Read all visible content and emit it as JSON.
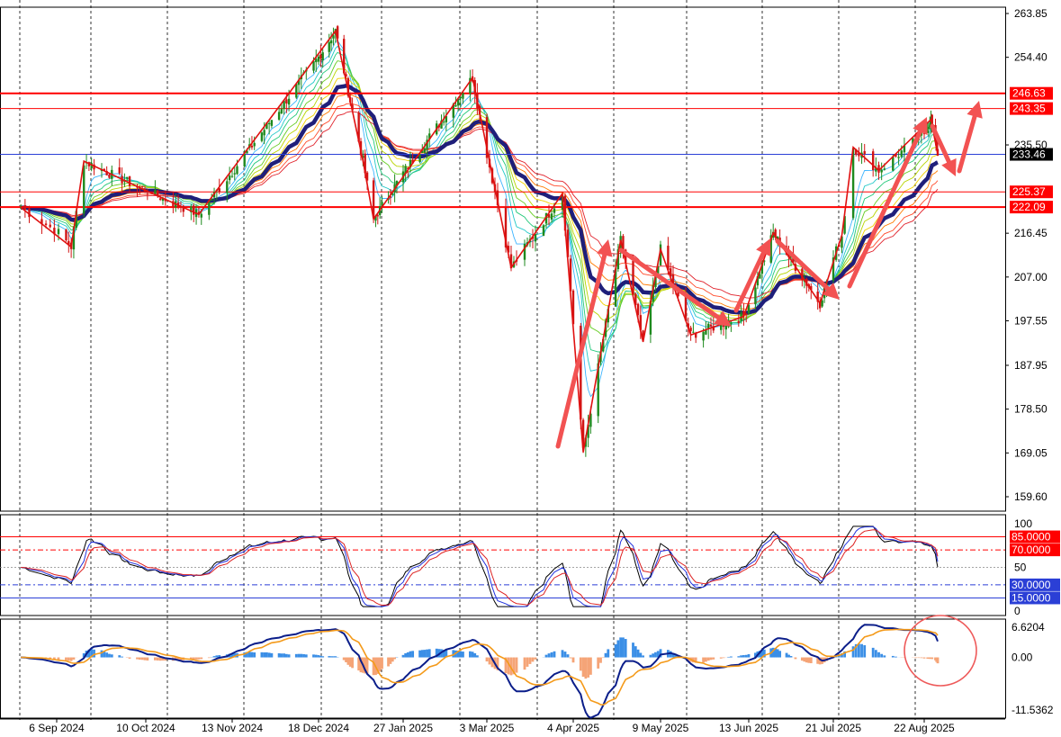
{
  "chart_data": [
    {
      "type": "candlestick",
      "title": "",
      "ylim": [
        159.6,
        263.85
      ],
      "y_ticks": [
        "263.85",
        "254.40",
        "235.50",
        "216.45",
        "207.00",
        "197.55",
        "187.95",
        "178.50",
        "169.05",
        "159.60"
      ],
      "x_ticks": [
        "6 Sep 2024",
        "10 Oct 2024",
        "13 Nov 2024",
        "18 Dec 2024",
        "27 Jan 2025",
        "3 Mar 2025",
        "4 Apr 2025",
        "9 May 2025",
        "13 Jun 2025",
        "21 Jul 2025",
        "22 Aug 2025"
      ],
      "horizontal_levels": [
        {
          "value": 246.63,
          "label": "246.63",
          "color": "#ff0000",
          "bold": true
        },
        {
          "value": 243.35,
          "label": "243.35",
          "color": "#ff0000",
          "bold": false
        },
        {
          "value": 233.46,
          "label": "233.46",
          "color": "#2b3fd6",
          "bold": false,
          "current_price": true
        },
        {
          "value": 225.37,
          "label": "225.37",
          "color": "#ff0000",
          "bold": false
        },
        {
          "value": 222.09,
          "label": "222.09",
          "color": "#ff0000",
          "bold": true
        }
      ],
      "key_points": [
        {
          "date": "2024-08-28",
          "price": 222.0
        },
        {
          "date": "2024-09-11",
          "price": 213.5
        },
        {
          "date": "2024-09-16",
          "price": 232.0
        },
        {
          "date": "2024-10-09",
          "price": 226.0
        },
        {
          "date": "2024-10-31",
          "price": 220.5
        },
        {
          "date": "2024-12-26",
          "price": 260.1
        },
        {
          "date": "2025-01-08",
          "price": 232.0
        },
        {
          "date": "2025-01-13",
          "price": 219.5
        },
        {
          "date": "2025-02-25",
          "price": 250.0
        },
        {
          "date": "2025-03-12",
          "price": 209.0
        },
        {
          "date": "2025-03-31",
          "price": 225.0
        },
        {
          "date": "2025-04-08",
          "price": 169.2
        },
        {
          "date": "2025-04-23",
          "price": 215.0
        },
        {
          "date": "2025-05-02",
          "price": 193.0
        },
        {
          "date": "2025-05-09",
          "price": 213.0
        },
        {
          "date": "2025-05-21",
          "price": 194.5
        },
        {
          "date": "2025-06-11",
          "price": 198.5
        },
        {
          "date": "2025-06-24",
          "price": 216.5
        },
        {
          "date": "2025-07-15",
          "price": 201.3
        },
        {
          "date": "2025-07-24",
          "price": 216.0
        },
        {
          "date": "2025-07-28",
          "price": 235.0
        },
        {
          "date": "2025-08-06",
          "price": 230.0
        },
        {
          "date": "2025-08-28",
          "price": 241.0
        },
        {
          "date": "2025-09-03",
          "price": 233.5
        }
      ]
    },
    {
      "type": "line",
      "ylim": [
        0,
        100
      ],
      "y_ticks": [
        "100",
        "50",
        "0"
      ],
      "levels": [
        {
          "value": 85,
          "label": "85.0000",
          "color": "#ff0000"
        },
        {
          "value": 70,
          "label": "70.0000",
          "color": "#ff0000"
        },
        {
          "value": 30,
          "label": "30.0000",
          "color": "#2b3fd6"
        },
        {
          "value": 15,
          "label": "15.0000",
          "color": "#2b3fd6"
        }
      ]
    },
    {
      "type": "bar",
      "ylim": [
        -11.5362,
        6.6204
      ],
      "y_ticks": [
        "6.6204",
        "0.00",
        "-11.5362"
      ]
    }
  ]
}
